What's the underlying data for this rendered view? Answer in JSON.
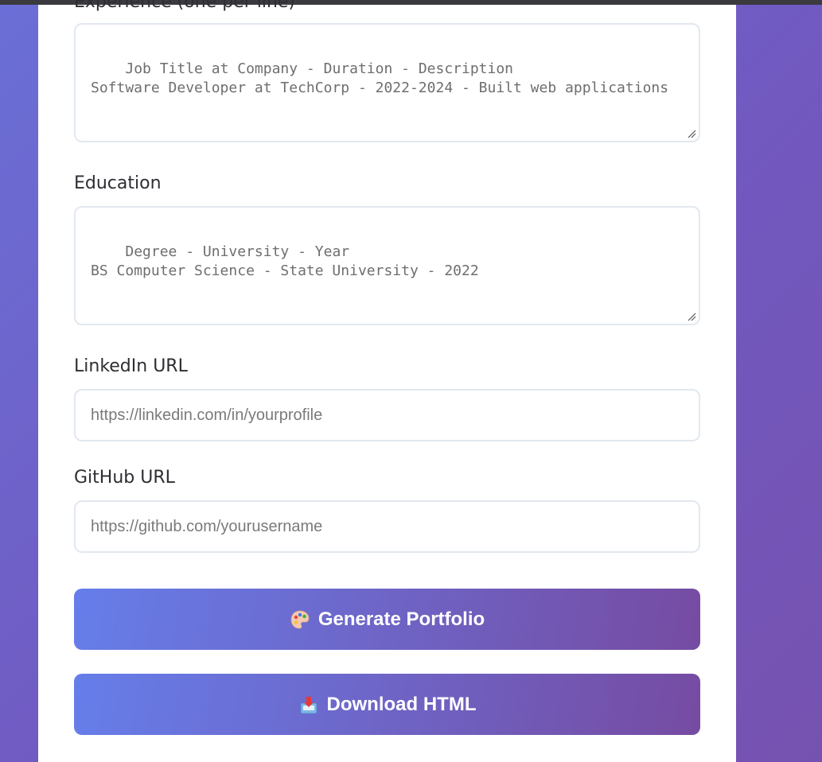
{
  "form": {
    "experience": {
      "label": "Experience (one per line)",
      "placeholder": "Job Title at Company - Duration - Description\nSoftware Developer at TechCorp - 2022-2024 - Built web applications"
    },
    "education": {
      "label": "Education",
      "placeholder": "Degree - University - Year\nBS Computer Science - State University - 2022"
    },
    "linkedin": {
      "label": "LinkedIn URL",
      "placeholder": "https://linkedin.com/in/yourprofile"
    },
    "github": {
      "label": "GitHub URL",
      "placeholder": "https://github.com/yourusername"
    }
  },
  "actions": {
    "generate": {
      "label": "Generate Portfolio",
      "icon": "palette-icon"
    },
    "download": {
      "label": "Download HTML",
      "icon": "download-inbox-icon"
    }
  },
  "colors": {
    "page_gradient_start": "#6a6fd6",
    "page_gradient_end": "#7652b0",
    "button_gradient_start": "#667eea",
    "button_gradient_end": "#764ba2",
    "field_border": "#e2e8f0"
  }
}
